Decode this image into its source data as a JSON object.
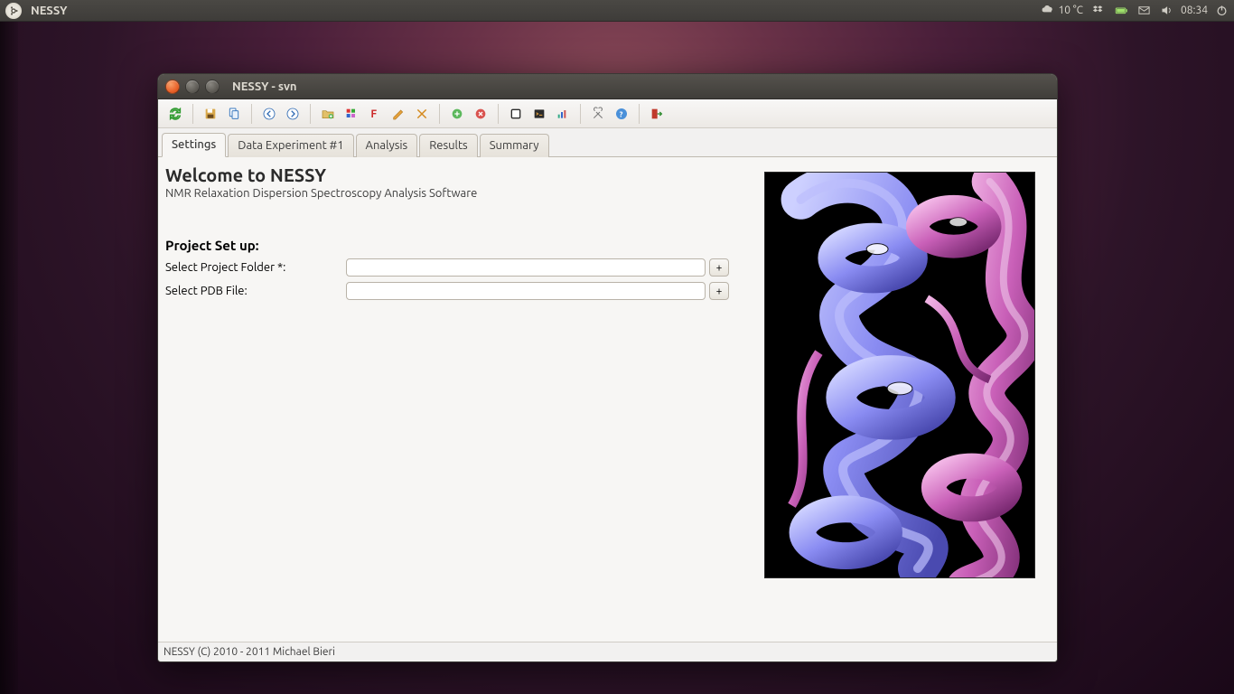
{
  "panel": {
    "app_name": "NESSY",
    "temperature": "10 °C",
    "clock": "08:34"
  },
  "window": {
    "title": "NESSY - svn",
    "tabs": [
      {
        "label": "Settings",
        "active": true
      },
      {
        "label": "Data Experiment #1",
        "active": false
      },
      {
        "label": "Analysis",
        "active": false
      },
      {
        "label": "Results",
        "active": false
      },
      {
        "label": "Summary",
        "active": false
      }
    ],
    "welcome_heading": "Welcome to NESSY",
    "subtitle": "NMR Relaxation Dispersion Spectroscopy Analysis Software",
    "section_heading": "Project Set up:",
    "form": {
      "project_folder": {
        "label": "Select Project Folder *:",
        "value": ""
      },
      "pdb_file": {
        "label": "Select PDB File:",
        "value": ""
      },
      "browse_label": "+"
    },
    "statusbar": "NESSY (C) 2010 - 2011 Michael Bieri"
  },
  "toolbar_icons": [
    "refresh",
    "save",
    "copy",
    "|",
    "back",
    "forward",
    "|",
    "new-folder",
    "color-sample",
    "font-f",
    "edit-pencil",
    "cut-x",
    "|",
    "add",
    "remove",
    "|",
    "stop-square",
    "terminal",
    "chart",
    "|",
    "tools",
    "help",
    "|",
    "exit"
  ]
}
